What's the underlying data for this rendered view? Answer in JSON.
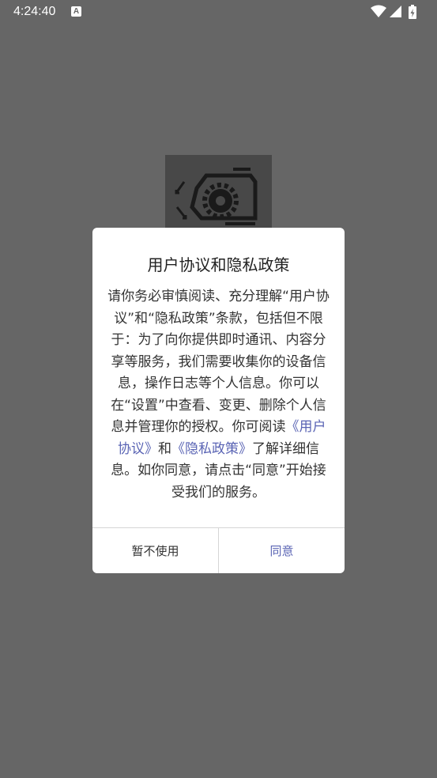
{
  "status_bar": {
    "time": "4:24:40",
    "notification_icon": "font-a-icon",
    "icons": [
      "wifi-icon",
      "signal-icon",
      "battery-charging-icon"
    ]
  },
  "splash": {
    "logo_icon": "gear-device-icon"
  },
  "dialog": {
    "title": "用户协议和隐私政策",
    "body_prefix": "请你务必审慎阅读、充分理解“用户协议”和“隐私政策”条款，包括但不限于：为了向你提供即时通讯、内容分享等服务，我们需要收集你的设备信息，操作日志等个人信息。你可以在“设置”中查看、变更、删除个人信息并管理你的授权。你可阅读",
    "link_user_agreement": "《用户协议》",
    "body_and": "和",
    "link_privacy_policy": "《隐私政策》",
    "body_suffix": "了解详细信息。如你同意，请点击“同意”开始接受我们的服务。",
    "cancel_label": "暂不使用",
    "agree_label": "同意"
  },
  "colors": {
    "overlay": "#666666",
    "link": "#5a64b4",
    "dialog_bg": "#ffffff"
  }
}
